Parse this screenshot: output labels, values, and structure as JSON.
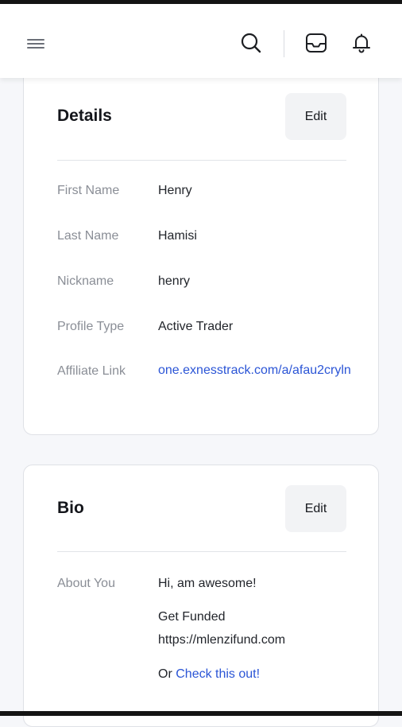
{
  "header": {
    "menu_icon": "hamburger-menu-icon",
    "search_icon": "search-icon",
    "inbox_icon": "inbox-icon",
    "notifications_icon": "bell-icon"
  },
  "details": {
    "title": "Details",
    "edit_label": "Edit",
    "fields": [
      {
        "label": "First Name",
        "value": "Henry"
      },
      {
        "label": "Last Name",
        "value": "Hamisi"
      },
      {
        "label": "Nickname",
        "value": "henry"
      },
      {
        "label": "Profile Type",
        "value": "Active Trader"
      },
      {
        "label": "Affiliate Link",
        "value": "one.exnesstrack.com/a/afau2cryln"
      }
    ]
  },
  "bio": {
    "title": "Bio",
    "edit_label": "Edit",
    "about_label": "About You",
    "line1": "Hi, am awesome!",
    "line2_text": "Get Funded",
    "line2_link": "https://mlenzifund.com",
    "line3_prefix": "Or",
    "line3_link": "Check this out!"
  },
  "colors": {
    "link": "#2b55d6",
    "label": "#8a8e96",
    "text": "#22252b",
    "card_border": "#dfe1e6",
    "page_bg": "#f6f7fa"
  }
}
